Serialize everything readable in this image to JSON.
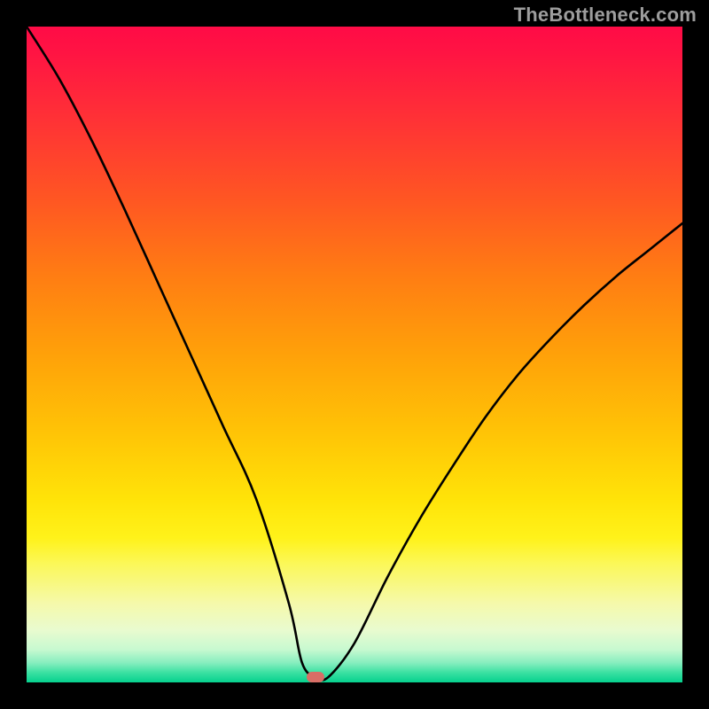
{
  "watermark": "TheBottleneck.com",
  "chart_data": {
    "type": "line",
    "title": "",
    "xlabel": "",
    "ylabel": "",
    "xlim": [
      0,
      100
    ],
    "ylim": [
      0,
      100
    ],
    "grid": false,
    "marker": {
      "x": 44,
      "y": 0.8
    },
    "series": [
      {
        "name": "curve",
        "x": [
          0,
          5,
          10,
          15,
          20,
          25,
          30,
          35,
          40,
          42,
          44,
          46,
          50,
          55,
          60,
          65,
          70,
          75,
          80,
          85,
          90,
          95,
          100
        ],
        "y": [
          100,
          92,
          82.5,
          72,
          61,
          50,
          39,
          28,
          12,
          3,
          0.8,
          0.8,
          6,
          16,
          25,
          33,
          40.5,
          47,
          52.5,
          57.5,
          62,
          66,
          70
        ]
      }
    ],
    "background_gradient_stops": [
      {
        "pos": 0,
        "color": "#ff0b46"
      },
      {
        "pos": 14,
        "color": "#ff3136"
      },
      {
        "pos": 38,
        "color": "#ff7d13"
      },
      {
        "pos": 62,
        "color": "#ffc406"
      },
      {
        "pos": 82,
        "color": "#fbf85a"
      },
      {
        "pos": 95,
        "color": "#c7f9d0"
      },
      {
        "pos": 100,
        "color": "#06d18e"
      }
    ]
  }
}
